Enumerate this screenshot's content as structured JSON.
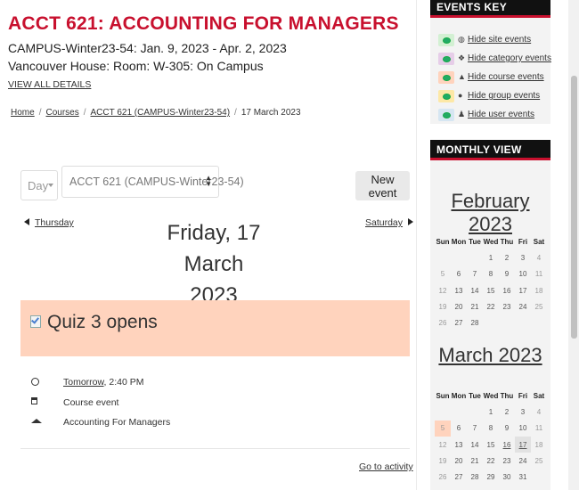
{
  "course": {
    "title": "ACCT 621: ACCOUNTING FOR MANAGERS",
    "line1": "CAMPUS-Winter23-54: Jan. 9, 2023 - Apr. 2, 2023",
    "line2": "Vancouver House: Room: W-305: On Campus",
    "view_all": "VIEW ALL DETAILS"
  },
  "breadcrumb": {
    "items": [
      "Home",
      "Courses",
      "ACCT 621 (CAMPUS-Winter23-54)",
      "17 March 2023"
    ]
  },
  "controls": {
    "view_select": "Day",
    "course_select": "ACCT 621 (CAMPUS-Winter23-54)",
    "new_event": "New event"
  },
  "day_nav": {
    "prev": "Thursday",
    "next": "Saturday",
    "heading_line1": "Friday, 17 March",
    "heading_line2": "2023"
  },
  "event": {
    "title": "Quiz 3 opens",
    "time_link": "Tomorrow",
    "time_rest": ", 2:40 PM",
    "type": "Course event",
    "course_link": "Accounting For Managers",
    "go_to_activity": "Go to activity",
    "header_color": "#ffd3bd"
  },
  "events_key": {
    "title": "EVENTS KEY",
    "items": [
      {
        "label": "Hide site events",
        "icon": "globe-icon",
        "color": "#d3f0d3"
      },
      {
        "label": "Hide category events",
        "icon": "cubes-icon",
        "color": "#e6cde8"
      },
      {
        "label": "Hide course events",
        "icon": "graduation-cap-icon",
        "color": "#ffd3bd"
      },
      {
        "label": "Hide group events",
        "icon": "users-icon",
        "color": "#fde8a6"
      },
      {
        "label": "Hide user events",
        "icon": "user-icon",
        "color": "#d6e6f2"
      }
    ]
  },
  "monthly_view": {
    "title": "MONTHLY VIEW",
    "weekdays": [
      "Sun",
      "Mon",
      "Tue",
      "Wed",
      "Thu",
      "Fri",
      "Sat"
    ],
    "february": {
      "title": "February 2023",
      "weeks": [
        [
          "",
          "",
          "",
          "1",
          "2",
          "3",
          "4"
        ],
        [
          "5",
          "6",
          "7",
          "8",
          "9",
          "10",
          "11"
        ],
        [
          "12",
          "13",
          "14",
          "15",
          "16",
          "17",
          "18"
        ],
        [
          "19",
          "20",
          "21",
          "22",
          "23",
          "24",
          "25"
        ],
        [
          "26",
          "27",
          "28",
          "",
          "",
          "",
          ""
        ]
      ]
    },
    "march": {
      "title": "March 2023",
      "weeks": [
        [
          "",
          "",
          "",
          "1",
          "2",
          "3",
          "4"
        ],
        [
          "5",
          "6",
          "7",
          "8",
          "9",
          "10",
          "11"
        ],
        [
          "12",
          "13",
          "14",
          "15",
          "16",
          "17",
          "18"
        ],
        [
          "19",
          "20",
          "21",
          "22",
          "23",
          "24",
          "25"
        ],
        [
          "26",
          "27",
          "28",
          "29",
          "30",
          "31",
          ""
        ]
      ],
      "event_day": "5",
      "today": "16",
      "selected_day": "17"
    }
  }
}
